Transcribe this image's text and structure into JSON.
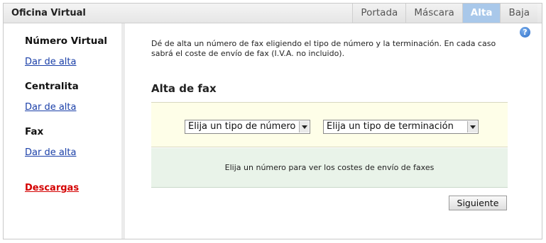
{
  "app": {
    "title": "Oficina Virtual"
  },
  "tabs": [
    {
      "label": "Portada",
      "active": false
    },
    {
      "label": "Máscara",
      "active": false
    },
    {
      "label": "Alta",
      "active": true
    },
    {
      "label": "Baja",
      "active": false
    }
  ],
  "sidebar": {
    "sections": [
      {
        "heading": "Número Virtual",
        "link": "Dar de alta"
      },
      {
        "heading": "Centralita",
        "link": "Dar de alta"
      },
      {
        "heading": "Fax",
        "link": "Dar de alta"
      }
    ],
    "downloads": "Descargas"
  },
  "help": {
    "glyph": "?"
  },
  "main": {
    "intro": "Dé de alta un número de fax eligiendo el tipo de número y la terminación. En cada caso sabrá el coste de envío de fax (I.V.A. no incluido).",
    "section_title": "Alta de fax",
    "number_type_select": "Elija un tipo de número",
    "termination_select": "Elija un tipo de terminación",
    "info_text": "Elija un número para ver los costes de envío de faxes",
    "next_button": "Siguiente"
  },
  "colors": {
    "active_tab": "#a9c8ea",
    "link": "#1a3fa8",
    "downloads": "#d40000",
    "select_band": "#fefee8",
    "info_band": "#e9f3e9"
  }
}
